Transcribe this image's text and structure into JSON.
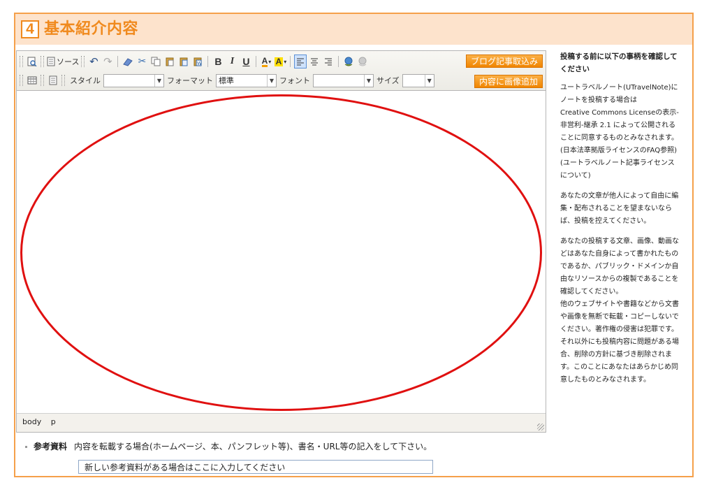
{
  "section": {
    "number": "4",
    "title": "基本紹介内容"
  },
  "toolbar": {
    "source_label": "ソース",
    "bold": "B",
    "italic": "I",
    "underline": "U",
    "text_color": "A",
    "bg_color": "A",
    "style_label": "スタイル",
    "style_value": "",
    "format_label": "フォーマット",
    "format_value": "標準",
    "font_label": "フォント",
    "font_value": "",
    "size_label": "サイズ",
    "size_value": "",
    "blog_import_button": "ブログ記事取込み",
    "add_image_button": "内容に画像追加"
  },
  "editor": {
    "path": [
      "body",
      "p"
    ],
    "annotation_color": "#e01010"
  },
  "sidebar": {
    "heading": "投稿する前に以下の事柄を確認してください",
    "para1": [
      "ユートラベルノート(UTravelNote)にノートを投稿する場合は",
      "Creative Commons Licenseの表示-非営利-継承 2.1 によって公開されることに同意するものとみなされます。",
      "(日本法準拠版ライセンスのFAQ参照)(ユートラベルノート記事ライセンスについて)"
    ],
    "para2": "あなたの文章が他人によって自由に編集・配布されることを望まないならば、投稿を控えてください。",
    "para3": [
      "あなたの投稿する文章、画像、動画などはあなた自身によって書かれたものであるか、パブリック・ドメインか自由なリソースからの複製であることを確認してください。",
      "他のウェブサイトや書籍などから文書や画像を無断で転載・コピーしないでください。著作権の侵害は犯罪です。",
      "それ以外にも投稿内容に問題がある場合、削除の方針に基づき削除されます。このことにあなたはあらかじめ同意したものとみなされます。"
    ]
  },
  "reference": {
    "label": "参考資料",
    "description": "内容を転載する場合(ホームページ、本、パンフレット等)、書名・URL等の記入をして下さい。",
    "input_value": "新しい参考資料がある場合はここに入力してください"
  }
}
